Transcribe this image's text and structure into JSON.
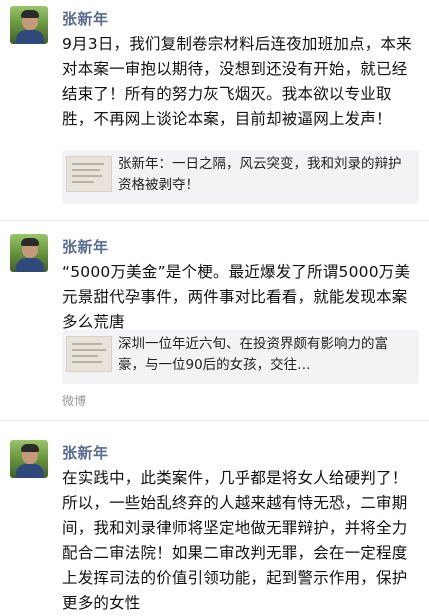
{
  "posts": [
    {
      "author": "张新年",
      "text": "9月3日，我们复制卷宗材料后连夜加班加点，本来对本案一审抱以期待，没想到还没有开始，就已经结束了！所有的努力灰飞烟灭。我本欲以专业取胜，不再网上谈论本案，目前却被逼网上发声！",
      "card": {
        "text": "张新年：一日之隔，风云突变，我和刘录的辩护资格被剥夺！"
      }
    },
    {
      "author": "张新年",
      "text": "“5000万美金”是个梗。最近爆发了所谓5000万美元景甜代孕事件，两件事对比看看，就能发现本案多么荒唐",
      "card": {
        "text": "深圳一位年近六旬、在投资界颇有影响力的富豪，与一位90后的女孩，交往…"
      },
      "source": "微博"
    },
    {
      "author": "张新年",
      "text": "在实践中，此类案件，几乎都是将女人给硬判了！所以，一些始乱终弃的人越来越有恃无恐，二审期间，我和刘录律师将坚定地做无罪辩护，并将全力配合二审法院！如果二审改判无罪，会在一定程度上发挥司法的价值引领功能，起到警示作用，保护更多的女性"
    }
  ]
}
